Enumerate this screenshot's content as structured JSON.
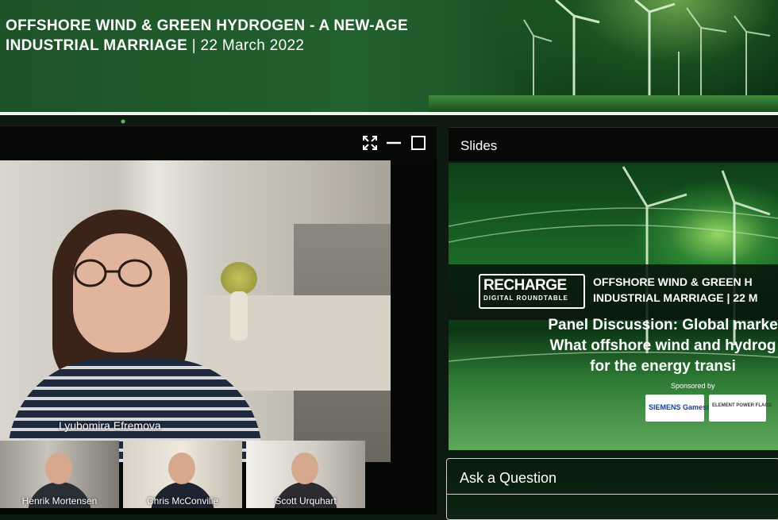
{
  "banner": {
    "title_line1": "OFFSHORE WIND & GREEN HYDROGEN - A NEW-AGE",
    "title_line2_bold": "INDUSTRIAL MARRIAGE",
    "title_line2_date": " | 22 March 2022"
  },
  "video": {
    "toolbar_icons": [
      "fullscreen-icon",
      "minimize-icon",
      "maximize-icon"
    ],
    "main_speaker": "Lyubomira Efremova",
    "participants": [
      "Henrik Mortensen",
      "Chris McConville",
      "Scott Urquhart"
    ]
  },
  "slides": {
    "header": "Slides",
    "logo_main": "RECHARGE",
    "logo_sub": "DIGITAL ROUNDTABLE",
    "heading_line1": "OFFSHORE WIND & GREEN H",
    "heading_line2": "INDUSTRIAL MARRIAGE | 22 M",
    "panel_line1": "Panel Discussion: Global marke",
    "panel_line2": "What offshore wind and hydrog",
    "panel_line3": "for the energy transi",
    "sponsored_by": "Sponsored by",
    "sponsor1": "SIEMENS Gamesa",
    "sponsor2": "ELEMENT POWER FLAGS"
  },
  "ask": {
    "title": "Ask a Question"
  },
  "colors": {
    "banner_green": "#22602d",
    "panel_dark": "#060906",
    "accent_white": "#ffffff"
  }
}
